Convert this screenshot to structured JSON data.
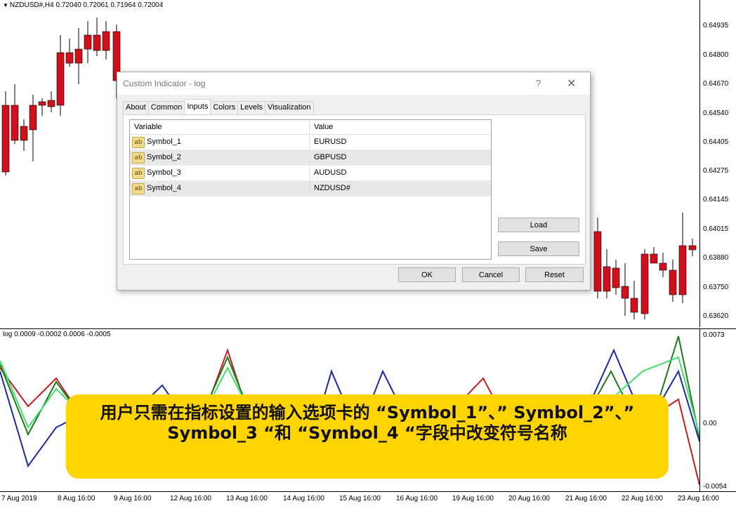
{
  "main_chart": {
    "header": "NZDUSD#,H4  0.72040 0.72061 0.71964 0.72004",
    "price_ticks": [
      "0.64935",
      "0.64800",
      "0.64670",
      "0.64540",
      "0.64405",
      "0.64275",
      "0.64145",
      "0.64015",
      "0.63880",
      "0.63750",
      "0.63620"
    ],
    "bull_color": "#2ee87a",
    "bear_color": "#d0101a"
  },
  "sub_window": {
    "header": "log 0.0009 -0.0002 0.0006 -0.0005",
    "axis_ticks": [
      "0.0073",
      "0.00",
      "-0.0054"
    ],
    "series_colors": [
      "#c41e1e",
      "#1a2aa0",
      "#1e7a1e",
      "#3fe06a"
    ]
  },
  "time_axis": {
    "labels": [
      "7 Aug 2019",
      "8 Aug 16:00",
      "9 Aug 16:00",
      "12 Aug 16:00",
      "13 Aug 16:00",
      "14 Aug 16:00",
      "15 Aug 16:00",
      "16 Aug 16:00",
      "19 Aug 16:00",
      "20 Aug 16:00",
      "21 Aug 16:00",
      "22 Aug 16:00",
      "23 Aug 16:00"
    ]
  },
  "dialog": {
    "title": "Custom Indicator - log",
    "help": "?",
    "close": "✕",
    "tabs": [
      "About",
      "Common",
      "Inputs",
      "Colors",
      "Levels",
      "Visualization"
    ],
    "active_tab": "Inputs",
    "columns": [
      "Variable",
      "Value"
    ],
    "rows": [
      {
        "icon": "ab",
        "variable": "Symbol_1",
        "value": "EURUSD"
      },
      {
        "icon": "ab",
        "variable": "Symbol_2",
        "value": "GBPUSD"
      },
      {
        "icon": "ab",
        "variable": "Symbol_3",
        "value": "AUDUSD"
      },
      {
        "icon": "ab",
        "variable": "Symbol_4",
        "value": "NZDUSD#"
      }
    ],
    "buttons": {
      "load": "Load",
      "save": "Save",
      "ok": "OK",
      "cancel": "Cancel",
      "reset": "Reset"
    }
  },
  "caption": {
    "text": "用户只需在指标设置的输入选项卡的 “Symbol_1”、” Symbol_2”、” Symbol_3 “和 “Symbol_4 “字段中改变符号名称"
  }
}
